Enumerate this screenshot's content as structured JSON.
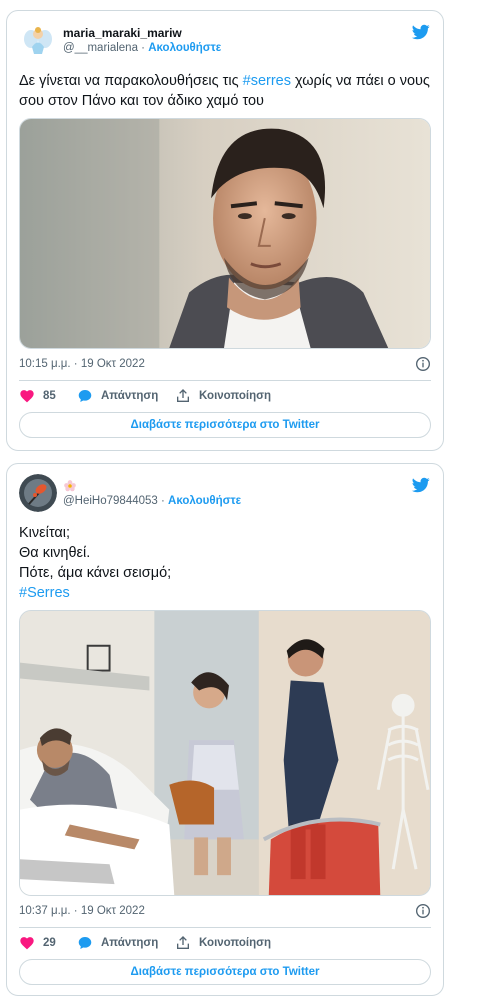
{
  "tweets": [
    {
      "display_name": "maria_maraki_mariw",
      "handle": "@__marialena",
      "separator": "·",
      "follow_label": "Ακολουθήστε",
      "text_before": "Δε γίνεται να παρακολουθήσεις τις ",
      "hashtag": "#serres",
      "text_after": " χωρίς να πάει ο νους σου στον Πάνο και τον άδικο χαμό του",
      "time": "10:15 μ.μ. · 19 Οκτ 2022",
      "likes": "85",
      "reply_label": "Απάντηση",
      "share_label": "Κοινοποίηση",
      "read_more_label": "Διαβάστε περισσότερα στο Twitter"
    },
    {
      "display_name": "",
      "handle": "@HeiHo79844053",
      "separator": "·",
      "follow_label": "Ακολουθήστε",
      "lines": [
        "Κινείται;",
        "Θα κινηθεί.",
        "Πότε, άμα κάνει σεισμό;"
      ],
      "hashtag": "#Serres",
      "time": "10:37 μ.μ. · 19 Οκτ 2022",
      "likes": "29",
      "reply_label": "Απάντηση",
      "share_label": "Κοινοποίηση",
      "read_more_label": "Διαβάστε περισσότερα στο Twitter"
    }
  ],
  "colors": {
    "accent": "#1d9bf0",
    "like": "#f91880",
    "text": "#0f1419",
    "muted": "#536471",
    "border": "#cfd9de"
  },
  "icons": [
    "twitter-logo-icon",
    "info-icon",
    "heart-icon",
    "reply-bubble-icon",
    "share-icon"
  ]
}
